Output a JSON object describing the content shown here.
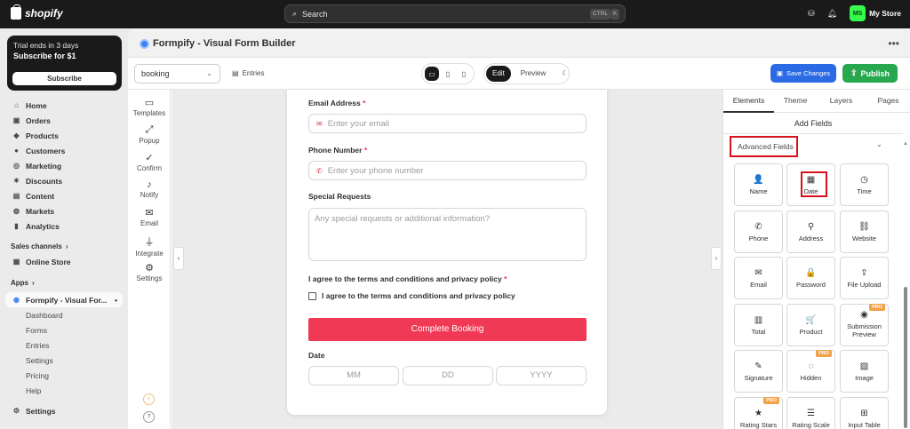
{
  "topbar": {
    "brand": "shopify",
    "search_placeholder": "Search",
    "kbd1": "CTRL",
    "kbd2": "K",
    "store_initials": "MS",
    "store_name": "My Store"
  },
  "trial": {
    "line1": "Trial ends in 3 days",
    "line2": "Subscribe for $1",
    "button": "Subscribe"
  },
  "nav": {
    "items": [
      {
        "label": "Home",
        "icon": "home-icon",
        "glyph": "⌂"
      },
      {
        "label": "Orders",
        "icon": "orders-icon",
        "glyph": "▣"
      },
      {
        "label": "Products",
        "icon": "tag-icon",
        "glyph": "◆"
      },
      {
        "label": "Customers",
        "icon": "person-icon",
        "glyph": "●"
      },
      {
        "label": "Marketing",
        "icon": "target-icon",
        "glyph": "◎"
      },
      {
        "label": "Discounts",
        "icon": "discount-icon",
        "glyph": "✷"
      },
      {
        "label": "Content",
        "icon": "content-icon",
        "glyph": "▤"
      },
      {
        "label": "Markets",
        "icon": "globe-icon",
        "glyph": "◍"
      },
      {
        "label": "Analytics",
        "icon": "chart-icon",
        "glyph": "▮"
      }
    ],
    "sales_channels": "Sales channels",
    "online_store": "Online Store",
    "apps": "Apps",
    "app_name": "Formpify - Visual For...",
    "app_subs": [
      "Dashboard",
      "Forms",
      "Entries",
      "Settings",
      "Pricing",
      "Help"
    ],
    "settings": "Settings"
  },
  "header": {
    "title": "Formpify - Visual Form Builder",
    "more": "•••"
  },
  "toolbar": {
    "form_select": "booking",
    "entries": "Entries",
    "edit": "Edit",
    "preview": "Preview",
    "save": "Save Changes",
    "publish": "Publish"
  },
  "rail": [
    {
      "label": "Templates",
      "glyph": "▭",
      "icon": "folder-icon"
    },
    {
      "label": "Popup",
      "glyph": "⤢",
      "icon": "expand-icon"
    },
    {
      "label": "Confirm",
      "glyph": "✓",
      "icon": "check-circle-icon"
    },
    {
      "label": "Notify",
      "glyph": "♪",
      "icon": "bell-icon"
    },
    {
      "label": "Email",
      "glyph": "✉",
      "icon": "mail-icon"
    },
    {
      "label": "Integrate",
      "glyph": "⏚",
      "icon": "plug-icon"
    },
    {
      "label": "Settings",
      "glyph": "⚙",
      "icon": "gear-icon"
    }
  ],
  "form": {
    "email_label": "Email Address",
    "email_ph": "Enter your email",
    "phone_label": "Phone Number",
    "phone_ph": "Enter your phone number",
    "special_label": "Special Requests",
    "special_ph": "Any special requests or additional information?",
    "terms_label": "I agree to the terms and conditions and privacy policy",
    "terms_check": "I agree to the terms and conditions and privacy policy",
    "submit": "Complete Booking",
    "date_label": "Date",
    "mm": "MM",
    "dd": "DD",
    "yyyy": "YYYY",
    "req": "*"
  },
  "panel": {
    "tabs": [
      "Elements",
      "Theme",
      "Layers",
      "Pages"
    ],
    "add_fields": "Add Fields",
    "advanced": "Advanced Fields",
    "tiles": [
      {
        "label": "Name",
        "glyph": "👤",
        "icon": "person-icon",
        "pro": ""
      },
      {
        "label": "Date",
        "glyph": "▦",
        "icon": "calendar-icon",
        "pro": ""
      },
      {
        "label": "Time",
        "glyph": "◷",
        "icon": "clock-icon",
        "pro": ""
      },
      {
        "label": "Phone",
        "glyph": "✆",
        "icon": "phone-icon",
        "pro": ""
      },
      {
        "label": "Address",
        "glyph": "⚲",
        "icon": "location-icon",
        "pro": ""
      },
      {
        "label": "Website",
        "glyph": "⛓",
        "icon": "link-icon",
        "pro": ""
      },
      {
        "label": "Email",
        "glyph": "✉",
        "icon": "mail-icon",
        "pro": ""
      },
      {
        "label": "Password",
        "glyph": "🔒",
        "icon": "lock-icon",
        "pro": ""
      },
      {
        "label": "File Upload",
        "glyph": "⇪",
        "icon": "upload-icon",
        "pro": ""
      },
      {
        "label": "Total",
        "glyph": "▥",
        "icon": "calculator-icon",
        "pro": ""
      },
      {
        "label": "Product",
        "glyph": "🛒",
        "icon": "cart-icon",
        "pro": ""
      },
      {
        "label": "Submission Preview",
        "glyph": "◉",
        "icon": "eye-icon",
        "pro": "PRO"
      },
      {
        "label": "Signature",
        "glyph": "✎",
        "icon": "pen-icon",
        "pro": ""
      },
      {
        "label": "Hidden",
        "glyph": "◌",
        "icon": "eye-off-icon",
        "pro": "PRO"
      },
      {
        "label": "Image",
        "glyph": "▨",
        "icon": "image-icon",
        "pro": ""
      },
      {
        "label": "Rating Stars",
        "glyph": "★",
        "icon": "star-icon",
        "pro": "PRO"
      },
      {
        "label": "Rating Scale",
        "glyph": "☰",
        "icon": "sliders-icon",
        "pro": ""
      },
      {
        "label": "Input Table",
        "glyph": "⊞",
        "icon": "table-icon",
        "pro": ""
      }
    ]
  },
  "colors": {
    "publish": "#27a74e",
    "save": "#2b6ae5",
    "submit": "#f03a55",
    "highlight": "#d8101c"
  }
}
